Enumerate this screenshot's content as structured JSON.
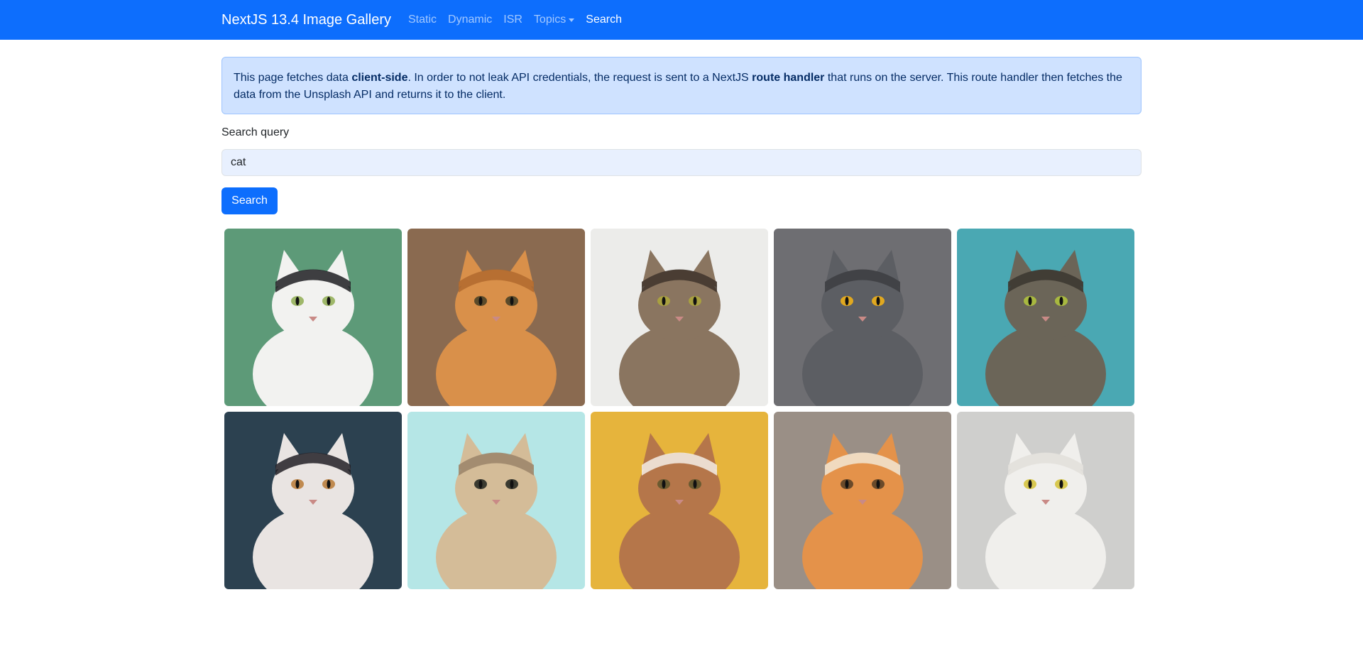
{
  "navbar": {
    "brand": "NextJS 13.4 Image Gallery",
    "links": [
      {
        "label": "Static"
      },
      {
        "label": "Dynamic"
      },
      {
        "label": "ISR"
      },
      {
        "label": "Topics"
      },
      {
        "label": "Search"
      }
    ],
    "active_link": "Search",
    "background_color": "#0d6efd"
  },
  "alert": {
    "text_1": "This page fetches data ",
    "bold_1": "client-side",
    "text_2": ". In order to not leak API credentials, the request is sent to a NextJS ",
    "bold_2": "route handler",
    "text_3": " that runs on the server. This route handler then fetches the data from the Unsplash API and returns it to the client."
  },
  "search": {
    "label": "Search query",
    "value": "cat",
    "button_label": "Search"
  },
  "results": [
    {
      "bg": "#5d9a78",
      "fur": "#f2f2f0",
      "patch": "#1f1f22",
      "eye": "#9fb86a"
    },
    {
      "bg": "#8a6a50",
      "fur": "#d9904a",
      "patch": "#b06a2e",
      "eye": "#5a4a2a"
    },
    {
      "bg": "#ececea",
      "fur": "#8a7560",
      "patch": "#3e342b",
      "eye": "#a8a040"
    },
    {
      "bg": "#6e6e72",
      "fur": "#5c5e63",
      "patch": "#3c3d41",
      "eye": "#e0a820"
    },
    {
      "bg": "#4aa8b3",
      "fur": "#6b6558",
      "patch": "#3a362f",
      "eye": "#a8b840"
    },
    {
      "bg": "#2c4150",
      "fur": "#e9e4e2",
      "patch": "#222026",
      "eye": "#c08a50"
    },
    {
      "bg": "#b5e6e6",
      "fur": "#d4bc98",
      "patch": "#9a8468",
      "eye": "#3a3a30"
    },
    {
      "bg": "#e6b43c",
      "fur": "#b5764a",
      "patch": "#f4efe6",
      "eye": "#6a5a30"
    },
    {
      "bg": "#9a8f86",
      "fur": "#e4924a",
      "patch": "#f2e6d4",
      "eye": "#6a4a2a"
    },
    {
      "bg": "#cfcfcd",
      "fur": "#f0efec",
      "patch": "#e2dfdb",
      "eye": "#d8c850"
    }
  ]
}
